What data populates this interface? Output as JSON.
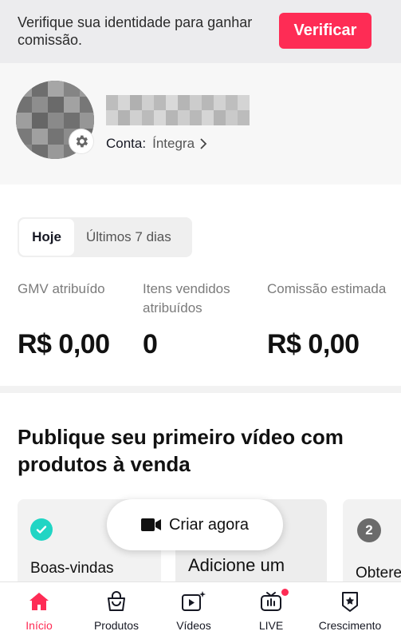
{
  "banner": {
    "text": "Verifique sua identidade para ganhar comissão.",
    "button": "Verificar"
  },
  "profile": {
    "account_label": "Conta:",
    "account_value": "Íntegra"
  },
  "stats": {
    "tabs": [
      "Hoje",
      "Últimos 7 dias"
    ],
    "items": [
      {
        "label": "GMV atribuído",
        "value": "R$ 0,00"
      },
      {
        "label": "Itens vendidos atribuídos",
        "value": "0"
      },
      {
        "label": "Comissão estimada",
        "value": "R$ 0,00"
      }
    ]
  },
  "publish": {
    "title": "Publique seu primeiro vídeo com produtos à venda",
    "cards": [
      {
        "text": "Boas-vindas",
        "status": "done"
      },
      {
        "text": "Adicione um"
      },
      {
        "number": "2",
        "text": "Obtere"
      }
    ],
    "create_button": "Criar agora"
  },
  "nav": {
    "items": [
      {
        "label": "Início",
        "icon": "home-icon",
        "active": true
      },
      {
        "label": "Produtos",
        "icon": "shopping-bag-icon"
      },
      {
        "label": "Vídeos",
        "icon": "video-sparkle-icon"
      },
      {
        "label": "LIVE",
        "icon": "live-tv-icon",
        "badge": true
      },
      {
        "label": "Crescimento",
        "icon": "star-badge-icon"
      }
    ]
  },
  "colors": {
    "accent": "#fe2c55",
    "check": "#20d5c4"
  }
}
